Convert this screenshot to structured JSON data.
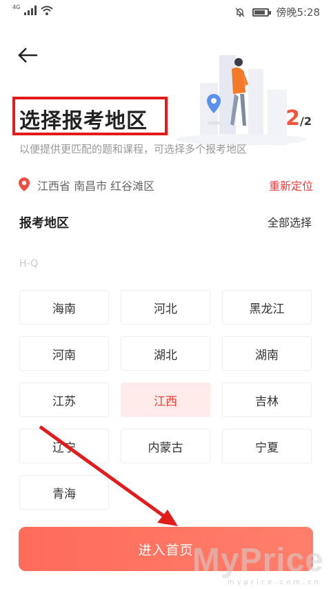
{
  "status_bar": {
    "network": "4G",
    "time": "傍晚5:28",
    "battery_level": 0.8
  },
  "header": {
    "title": "选择报考地区",
    "step_current": "2",
    "step_total": "/2",
    "subtitle": "以便提供更匹配的题和课程，可选择多个报考地区"
  },
  "location": {
    "text": "江西省 南昌市 红谷滩区",
    "relocate_label": "重新定位"
  },
  "region_section": {
    "title": "报考地区",
    "select_all_label": "全部选择",
    "group_label": "H-Q",
    "regions": [
      {
        "label": "海南",
        "selected": false
      },
      {
        "label": "河北",
        "selected": false
      },
      {
        "label": "黑龙江",
        "selected": false
      },
      {
        "label": "河南",
        "selected": false
      },
      {
        "label": "湖北",
        "selected": false
      },
      {
        "label": "湖南",
        "selected": false
      },
      {
        "label": "江苏",
        "selected": false
      },
      {
        "label": "江西",
        "selected": true
      },
      {
        "label": "吉林",
        "selected": false
      },
      {
        "label": "辽宁",
        "selected": false
      },
      {
        "label": "内蒙古",
        "selected": false
      },
      {
        "label": "宁夏",
        "selected": false
      },
      {
        "label": "青海",
        "selected": false
      }
    ]
  },
  "footer": {
    "enter_label": "进入首页"
  },
  "watermark": {
    "brand": "MyPrice",
    "url": "myprice.com.cn"
  },
  "colors": {
    "accent": "#f4533d",
    "selected_bg": "#ffecea",
    "annotation_red": "#e21b1b"
  },
  "icons": [
    "signal-icon",
    "wifi-icon",
    "mute-bell-icon",
    "battery-icon",
    "back-arrow-icon",
    "location-pin-icon"
  ]
}
